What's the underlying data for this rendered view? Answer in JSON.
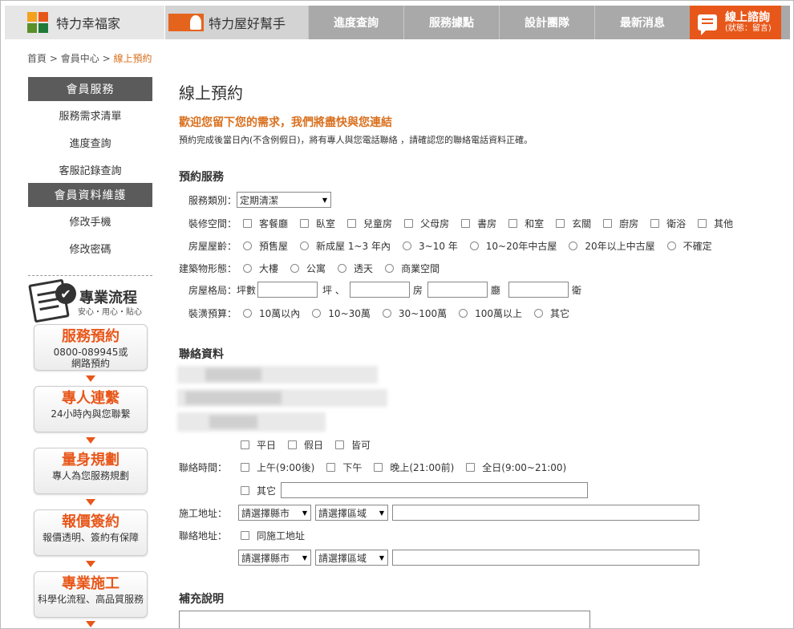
{
  "nav": {
    "brand1": "特力幸福家",
    "brand2": "特力屋好幫手",
    "items": [
      {
        "label": "進度查詢"
      },
      {
        "label": "服務據點"
      },
      {
        "label": "設計團隊"
      },
      {
        "label": "最新消息"
      }
    ],
    "consult_title": "線上諮詢",
    "consult_status": "(狀態：留言)",
    "colors": {
      "bar": "#a9a9a9",
      "accent": "#e8571a"
    }
  },
  "breadcrumb": {
    "home": "首頁",
    "sep": ">",
    "member": "會員中心",
    "current": "線上預約"
  },
  "sidebar": {
    "section1": "會員服務",
    "items1": [
      {
        "label": "服務需求清單"
      },
      {
        "label": "進度查詢"
      },
      {
        "label": "客服記錄查詢"
      }
    ],
    "section2": "會員資料維護",
    "items2": [
      {
        "label": "修改手機"
      },
      {
        "label": "修改密碼"
      }
    ],
    "flow_title": "專業流程",
    "flow_sub": "安心・用心・貼心",
    "steps": [
      {
        "title": "服務預約",
        "desc1": "0800-089945或",
        "desc2": "網路預約"
      },
      {
        "title": "專人連繫",
        "desc1": "24小時內與您聯繫",
        "desc2": ""
      },
      {
        "title": "量身規劃",
        "desc1": "專人為您服務規劃",
        "desc2": ""
      },
      {
        "title": "報價簽約",
        "desc1": "報價透明、簽約有保障",
        "desc2": ""
      },
      {
        "title": "專業施工",
        "desc1": "科學化流程、高品質服務",
        "desc2": ""
      }
    ]
  },
  "main": {
    "title": "線上預約",
    "welcome": "歡迎您留下您的需求，我們將盡快與您連結",
    "notice": "預約完成後當日內(不含例假日)，將有專人與您電話聯絡 ，請確認您的聯絡電話資料正確。",
    "booking_title": "預約服務",
    "service_type_label": "服務類別：",
    "service_type_value": "定期清潔",
    "space_label": "裝修空間：",
    "spaces": [
      {
        "label": "客餐廳"
      },
      {
        "label": "臥室"
      },
      {
        "label": "兒童房"
      },
      {
        "label": "父母房"
      },
      {
        "label": "書房"
      },
      {
        "label": "和室"
      },
      {
        "label": "玄關"
      },
      {
        "label": "廚房"
      },
      {
        "label": "衛浴"
      },
      {
        "label": "其他"
      }
    ],
    "age_label": "房屋屋齡：",
    "ages": [
      {
        "label": "預售屋"
      },
      {
        "label": "新成屋 1~3 年內"
      },
      {
        "label": "3~10 年"
      },
      {
        "label": "10~20年中古屋"
      },
      {
        "label": "20年以上中古屋"
      },
      {
        "label": "不確定"
      }
    ],
    "building_label": "建築物形態：",
    "buildings": [
      {
        "label": "大樓"
      },
      {
        "label": "公寓"
      },
      {
        "label": "透天"
      },
      {
        "label": "商業空間"
      }
    ],
    "layout_label": "房屋格局：",
    "layout_area": "坪數",
    "layout_ping": "坪 、",
    "layout_room": "房",
    "layout_hall": "廳",
    "layout_bath": "衛",
    "budget_label": "裝潢預算：",
    "budgets": [
      {
        "label": "10萬以內"
      },
      {
        "label": "10~30萬"
      },
      {
        "label": "30~100萬"
      },
      {
        "label": "100萬以上"
      },
      {
        "label": "其它"
      }
    ],
    "contact_title": "聯絡資料",
    "days": [
      {
        "label": "平日"
      },
      {
        "label": "假日"
      },
      {
        "label": "皆可"
      }
    ],
    "time_label": "聯絡時間：",
    "times": [
      {
        "label": "上午(9:00後)"
      },
      {
        "label": "下午"
      },
      {
        "label": "晚上(21:00前)"
      },
      {
        "label": "全日(9:00~21:00)"
      }
    ],
    "time_other": "其它",
    "site_addr_label": "施工地址：",
    "city_placeholder": "請選擇縣市",
    "area_placeholder": "請選擇區域",
    "contact_addr_label": "聯絡地址：",
    "same_as_site": "同施工地址",
    "notes_title": "補充說明"
  }
}
